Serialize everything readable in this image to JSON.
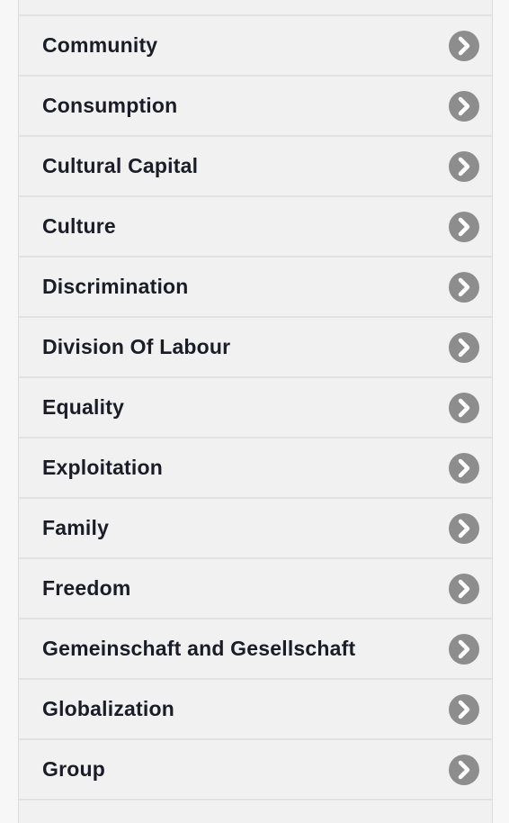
{
  "topics": {
    "items": [
      {
        "label": "Community"
      },
      {
        "label": "Consumption"
      },
      {
        "label": "Cultural Capital"
      },
      {
        "label": "Culture"
      },
      {
        "label": "Discrimination"
      },
      {
        "label": "Division Of Labour"
      },
      {
        "label": "Equality"
      },
      {
        "label": "Exploitation"
      },
      {
        "label": "Family"
      },
      {
        "label": "Freedom"
      },
      {
        "label": "Gemeinschaft and Gesellschaft"
      },
      {
        "label": "Globalization"
      },
      {
        "label": "Group"
      }
    ]
  },
  "icons": {
    "item_arrow": "chevron-right-circle-icon"
  },
  "colors": {
    "row_background": "#f1f1f1",
    "row_divider": "#e2e2e2",
    "label_text": "#1c1c28",
    "icon_circle": "#8d8d8d"
  }
}
